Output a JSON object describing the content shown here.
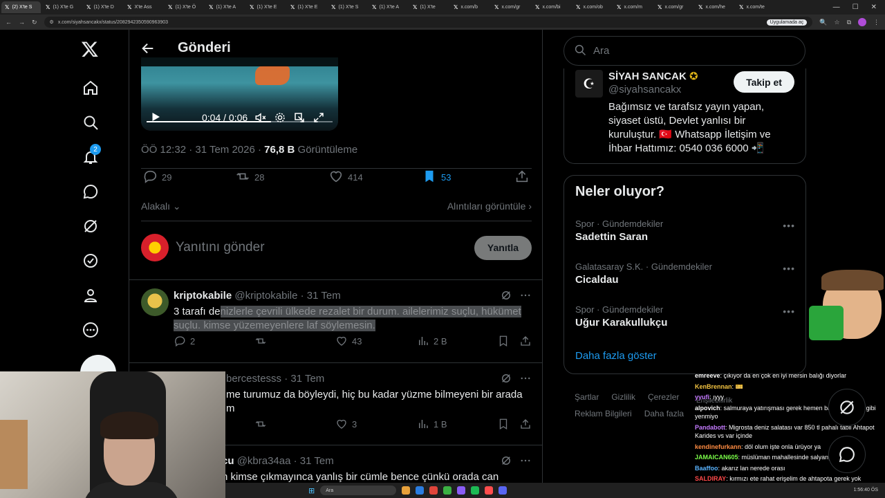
{
  "browser": {
    "tabs": [
      {
        "label": "(2) X'te S",
        "active": true
      },
      {
        "label": "(1) X'te G"
      },
      {
        "label": "(1) X'te D"
      },
      {
        "label": "X'te Ass"
      },
      {
        "label": "(1) X'te Ö"
      },
      {
        "label": "(1) X'te A"
      },
      {
        "label": "(1) X'te E"
      },
      {
        "label": "(1) X'te E"
      },
      {
        "label": "(1) X'te S"
      },
      {
        "label": "(1) X'te A"
      },
      {
        "label": "(1) X'te"
      },
      {
        "label": "x.com/b"
      },
      {
        "label": "x.com/gr"
      },
      {
        "label": "x.com/bi"
      },
      {
        "label": "x.com/ob"
      },
      {
        "label": "x.com/m"
      },
      {
        "label": "x.com/gr"
      },
      {
        "label": "x.com/he"
      },
      {
        "label": "x.com/te"
      }
    ],
    "url": "x.com/siyahsancakx/status/2082942350590963903",
    "open_in_app": "Uygulamada aç"
  },
  "nav": {
    "notification_count": "2"
  },
  "header": {
    "title": "Gönderi"
  },
  "video": {
    "time": "0:04 / 0:06",
    "progress": 0.67
  },
  "post": {
    "time": "ÖÖ 12:32 · 31 Tem 2026 · ",
    "views": "76,8 B",
    "views_label": " Görüntüleme",
    "replies": "29",
    "reposts": "28",
    "likes": "414",
    "bookmarks": "53",
    "related": "Alakalı",
    "quotes": "Alıntıları görüntüle",
    "reply_placeholder": "Yanıtını gönder",
    "reply_button": "Yanıtla"
  },
  "replies": [
    {
      "name": "kriptokabile",
      "handle": "@kriptokabile · 31 Tem",
      "text_plain": "3 tarafı de",
      "text_selected": "nizlerle çevrili ülkede rezalet bir durum. ailelerimiz suçlu, hükümet suçlu. kimse yüzemeyenlere laf söylemesin.",
      "replies": "2",
      "likes": "43",
      "views": "2 B"
    },
    {
      "handle": "bercestesss · 31 Tem",
      "text": "me turumuz da böyleydi, hiç bu kadar yüzme bilmeyeni bir arada",
      "text2": "m",
      "likes": "3",
      "views": "1 B"
    },
    {
      "name": "cu",
      "handle": "@kbra34aa · 31 Tem",
      "text": "n kimse çıkmayınca yanlış bir cümle bence çünkü orada can"
    }
  ],
  "sidebar": {
    "search_placeholder": "Ara",
    "profile": {
      "name": "SİYAH SANCAK",
      "handle": "@siyahsancakx",
      "follow": "Takip et",
      "bio": "Bağımsız ve tarafsız yayın yapan, siyaset üstü, Devlet yanlısı bir kuruluştur. 🇹🇷 Whatsapp İletişim ve İhbar Hattımız: 0540 036 6000 📲"
    },
    "trends_title": "Neler oluyor?",
    "trends": [
      {
        "category": "Spor · Gündemdekiler",
        "name": "Sadettin Saran"
      },
      {
        "category": "Galatasaray S.K. · Gündemdekiler",
        "name": "Cicaldau"
      },
      {
        "category": "Spor · Gündemdekiler",
        "name": "Uğur Karakullukçu"
      }
    ],
    "show_more": "Daha fazla göster",
    "footer": [
      "Şartlar",
      "Gizlilik",
      "Çerezler",
      "Erişilebilirlik",
      "Reklam Bilgileri",
      "Daha fazla"
    ]
  },
  "chat": [
    {
      "user": "emreeve",
      "msg": ": çıkıyor da en çok en iyi mersin balığı diyorlar",
      "color": "#ffffff"
    },
    {
      "user": "KenBrennan",
      "msg": ": 🎫",
      "color": "#f5c542"
    },
    {
      "user": "yyufi",
      "msg": ": ıyyy",
      "color": "#c57bff"
    },
    {
      "user": "alpovich",
      "msg": ": salmuraya yatırışması gerek hemen balıkları çıktığı gibi yenmiyo",
      "color": "#ffffff"
    },
    {
      "user": "Pandabott",
      "msg": ": Migrosta deniz salatası var 850 tl pahalı tabii Ahtapot Karides vs var içinde",
      "color": "#c57bff"
    },
    {
      "user": "kendinefurkann",
      "msg": ": döl olum işte onla ürüyor ya",
      "color": "#ff8c42"
    },
    {
      "user": "JAMAICAN605",
      "msg": ": müslüman mahallesinde salyangoz satılmaz",
      "color": "#7cff4a"
    },
    {
      "user": "Baaffoo",
      "msg": ": akarız lan nerede orası",
      "color": "#5ab4ff"
    },
    {
      "user": "SALDIRAY",
      "msg": ": kırmızı ete rahat erişelim de ahtapota gerek yok",
      "color": "#ff4a4a"
    }
  ],
  "taskbar": {
    "search": "Ara",
    "time": "1:56:40 ÖS"
  },
  "colors": {
    "accent": "#1d9bf0",
    "background": "#000000",
    "border": "#2f3336",
    "muted": "#71767b"
  }
}
